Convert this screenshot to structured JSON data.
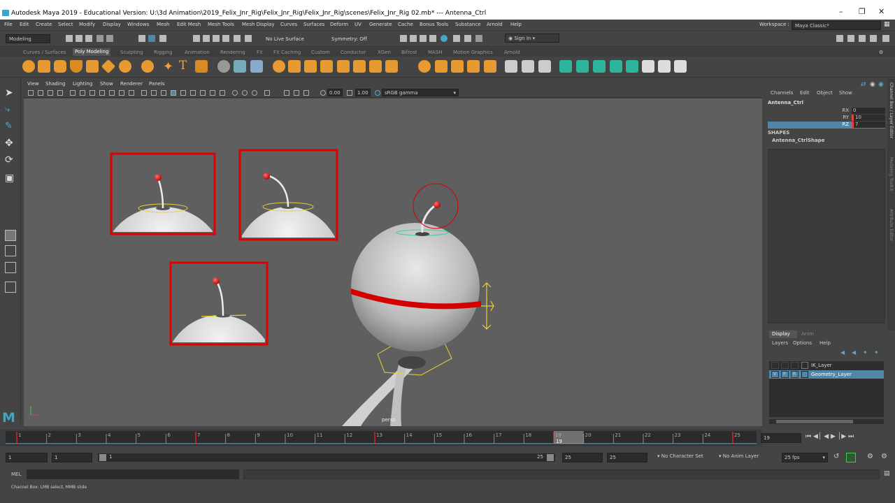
{
  "window": {
    "title": "Autodesk Maya 2019 - Educational Version: U:\\3d Animation\\2019_Felix_Jnr_Rig\\Felix_Jnr_Rig\\Felix_Jnr_Rig\\scenes\\Felix_Jnr_Rig 02.mb*  ---  Antenna_Ctrl"
  },
  "menus": [
    "File",
    "Edit",
    "Create",
    "Select",
    "Modify",
    "Display",
    "Windows",
    "Mesh",
    "Edit Mesh",
    "Mesh Tools",
    "Mesh Display",
    "Curves",
    "Surfaces",
    "Deform",
    "UV",
    "Generate",
    "Cache",
    "Bonus Tools",
    "Substance",
    "Arnold",
    "Help"
  ],
  "workspace": {
    "label": "Workspace :",
    "value": "Maya Classic*"
  },
  "status": {
    "menuset": "Modeling",
    "live_surface": "No Live Surface",
    "symmetry": "Symmetry: Off",
    "sign_in": "Sign In"
  },
  "shelf_tabs": [
    "Curves / Surfaces",
    "Poly Modeling",
    "Sculpting",
    "Rigging",
    "Animation",
    "Rendering",
    "FX",
    "FX Caching",
    "Custom",
    "Conductor",
    "XGen",
    "Bifrost",
    "MASH",
    "Motion Graphics",
    "Arnold"
  ],
  "viewport": {
    "menus": [
      "View",
      "Shading",
      "Lighting",
      "Show",
      "Renderer",
      "Panels"
    ],
    "near": "0.00",
    "far": "1.00",
    "color_space": "sRGB gamma",
    "camera_label": "persp"
  },
  "channel_box": {
    "menus": [
      "Channels",
      "Edit",
      "Object",
      "Show"
    ],
    "object": "Antenna_Ctrl",
    "attrs": [
      {
        "name": "RX",
        "value": "0"
      },
      {
        "name": "RY",
        "value": "10"
      },
      {
        "name": "RZ",
        "value": "7"
      }
    ],
    "shapes_label": "SHAPES",
    "shape": "Antenna_CtrlShape",
    "side_tabs": [
      "Channel Box / Layer Editor",
      "Modeling Toolkit",
      "Attribute Editor"
    ]
  },
  "layer_editor": {
    "tabs": [
      "Display",
      "Anim"
    ],
    "menus": [
      "Layers",
      "Options",
      "Help"
    ],
    "layers": [
      {
        "v": "",
        "p": "",
        "r": "",
        "name": "IK_Layer"
      },
      {
        "v": "V",
        "p": "P",
        "r": "R",
        "name": "Geometry_Layer"
      }
    ]
  },
  "timeline": {
    "ticks": [
      "1",
      "2",
      "3",
      "4",
      "5",
      "6",
      "7",
      "8",
      "9",
      "10",
      "11",
      "12",
      "13",
      "14",
      "15",
      "16",
      "17",
      "18",
      "19",
      "20",
      "21",
      "22",
      "23",
      "24",
      "25"
    ],
    "current": "19",
    "current_field": "19"
  },
  "range": {
    "start": "1",
    "inner_start": "1",
    "slider_start": "1",
    "slider_end": "25",
    "inner_end": "25",
    "end": "25",
    "char_set": "No Character Set",
    "anim_layer": "No Anim Layer",
    "fps": "25 fps"
  },
  "mel": {
    "label": "MEL"
  },
  "help": {
    "text": "Channel Box: LMB select, MMB slide"
  },
  "colors": {
    "accent": "#5285a6",
    "ctrl_red": "#e00000",
    "selection_green": "#4fd1a5"
  }
}
